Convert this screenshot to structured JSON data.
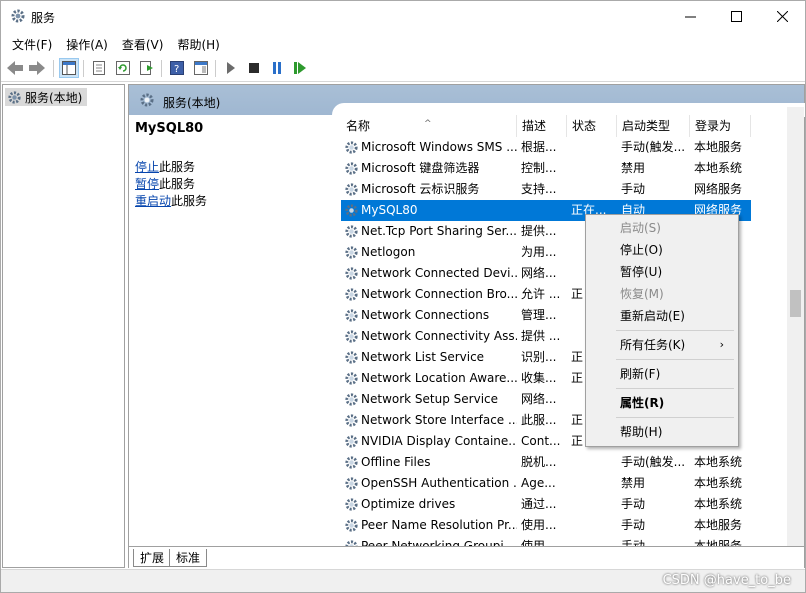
{
  "window": {
    "title": "服务",
    "minimize_icon": "minimize-icon",
    "maximize_icon": "maximize-icon",
    "close_icon": "close-icon"
  },
  "menubar": [
    "文件(F)",
    "操作(A)",
    "查看(V)",
    "帮助(H)"
  ],
  "tree": {
    "root_label": "服务(本地)"
  },
  "pane": {
    "header": "服务(本地)",
    "selected_service": "MySQL80",
    "actions": [
      {
        "link": "停止",
        "suffix": "此服务"
      },
      {
        "link": "暂停",
        "suffix": "此服务"
      },
      {
        "link": "重启动",
        "suffix": "此服务"
      }
    ]
  },
  "columns": [
    "名称",
    "描述",
    "状态",
    "启动类型",
    "登录为"
  ],
  "rows": [
    {
      "name": "Microsoft Windows SMS ...",
      "desc": "根据...",
      "status": "",
      "startup": "手动(触发...",
      "logon": "本地服务"
    },
    {
      "name": "Microsoft 键盘筛选器",
      "desc": "控制...",
      "status": "",
      "startup": "禁用",
      "logon": "本地系统"
    },
    {
      "name": "Microsoft 云标识服务",
      "desc": "支持...",
      "status": "",
      "startup": "手动",
      "logon": "网络服务"
    },
    {
      "name": "MySQL80",
      "desc": "",
      "status": "正在...",
      "startup": "自动",
      "logon": "网络服务",
      "selected": true
    },
    {
      "name": "Net.Tcp Port Sharing Ser...",
      "desc": "提供...",
      "status": "",
      "startup": "",
      "logon": "务"
    },
    {
      "name": "Netlogon",
      "desc": "为用...",
      "status": "",
      "startup": "",
      "logon": "统"
    },
    {
      "name": "Network Connected Devi...",
      "desc": "网络...",
      "status": "",
      "startup": "",
      "logon": "务"
    },
    {
      "name": "Network Connection Bro...",
      "desc": "允许 ...",
      "status": "正",
      "startup": "",
      "logon": "统"
    },
    {
      "name": "Network Connections",
      "desc": "管理...",
      "status": "",
      "startup": "",
      "logon": "统"
    },
    {
      "name": "Network Connectivity Ass...",
      "desc": "提供 ...",
      "status": "",
      "startup": "",
      "logon": "统"
    },
    {
      "name": "Network List Service",
      "desc": "识别...",
      "status": "正",
      "startup": "",
      "logon": "务"
    },
    {
      "name": "Network Location Aware...",
      "desc": "收集...",
      "status": "正",
      "startup": "",
      "logon": "务"
    },
    {
      "name": "Network Setup Service",
      "desc": "网络...",
      "status": "",
      "startup": "",
      "logon": "统"
    },
    {
      "name": "Network Store Interface ...",
      "desc": "此服...",
      "status": "正",
      "startup": "",
      "logon": "务"
    },
    {
      "name": "NVIDIA Display Containe...",
      "desc": "Cont...",
      "status": "正",
      "startup": "",
      "logon": "统"
    },
    {
      "name": "Offline Files",
      "desc": "脱机...",
      "status": "",
      "startup": "手动(触发...",
      "logon": "本地系统"
    },
    {
      "name": "OpenSSH Authentication ...",
      "desc": "Age...",
      "status": "",
      "startup": "禁用",
      "logon": "本地系统"
    },
    {
      "name": "Optimize drives",
      "desc": "通过...",
      "status": "",
      "startup": "手动",
      "logon": "本地系统"
    },
    {
      "name": "Peer Name Resolution Pr...",
      "desc": "使用...",
      "status": "",
      "startup": "手动",
      "logon": "本地服务"
    },
    {
      "name": "Peer Networking Groupi...",
      "desc": "使用...",
      "status": "",
      "startup": "手动",
      "logon": "本地服务"
    }
  ],
  "context_menu": [
    {
      "label": "启动(S)",
      "disabled": true
    },
    {
      "label": "停止(O)"
    },
    {
      "label": "暂停(U)"
    },
    {
      "label": "恢复(M)",
      "disabled": true
    },
    {
      "label": "重新启动(E)"
    },
    {
      "separator": true
    },
    {
      "label": "所有任务(K)",
      "submenu": true
    },
    {
      "separator": true
    },
    {
      "label": "刷新(F)"
    },
    {
      "separator": true
    },
    {
      "label": "属性(R)",
      "bold": true
    },
    {
      "separator": true
    },
    {
      "label": "帮助(H)"
    }
  ],
  "tabs": [
    "扩展",
    "标准"
  ],
  "watermark": "CSDN @have_to_be",
  "colors": {
    "selection": "#0078d7",
    "header_band": "#a9bfd6",
    "link": "#0645ad"
  }
}
